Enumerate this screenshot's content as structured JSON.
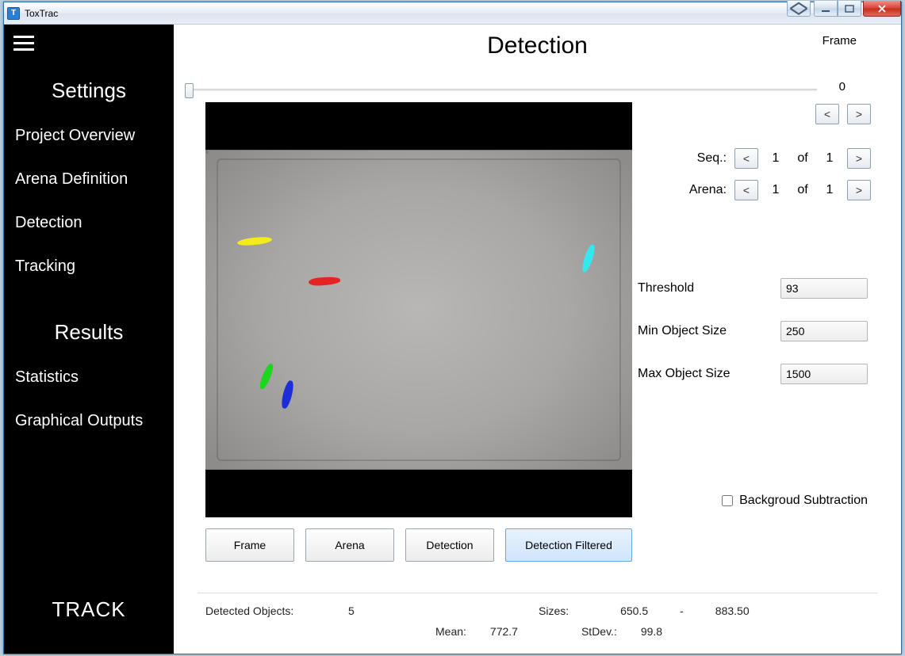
{
  "window": {
    "title": "ToxTrac",
    "icon_letter": "T"
  },
  "sidebar": {
    "sections": [
      {
        "title": "Settings",
        "items": [
          "Project Overview",
          "Arena Definition",
          "Detection",
          "Tracking"
        ]
      },
      {
        "title": "Results",
        "items": [
          "Statistics",
          "Graphical Outputs"
        ]
      }
    ],
    "track_button": "TRACK"
  },
  "page": {
    "title": "Detection",
    "frame_label": "Frame",
    "frame_value": "0"
  },
  "nav": {
    "seq": {
      "label": "Seq.:",
      "current": "1",
      "of": "of",
      "total": "1"
    },
    "arena": {
      "label": "Arena:",
      "current": "1",
      "of": "of",
      "total": "1"
    },
    "prev": "<",
    "next": ">"
  },
  "params": {
    "threshold": {
      "label": "Threshold",
      "value": "93"
    },
    "min_size": {
      "label": "Min Object Size",
      "value": "250"
    },
    "max_size": {
      "label": "Max Object Size",
      "value": "1500"
    },
    "bg_sub": {
      "label": "Backgroud Subtraction",
      "checked": false
    }
  },
  "tabs": {
    "frame": "Frame",
    "arena": "Arena",
    "detection": "Detection",
    "detection_filtered": "Detection Filtered"
  },
  "status": {
    "detected_label": "Detected Objects:",
    "detected_value": "5",
    "sizes_label": "Sizes:",
    "sizes_min": "650.5",
    "sizes_dash": "-",
    "sizes_max": "883.50",
    "mean_label": "Mean:",
    "mean_value": "772.7",
    "stdev_label": "StDev.:",
    "stdev_value": "99.8"
  },
  "blobs": [
    {
      "color": "#f5ea1a"
    },
    {
      "color": "#e52323"
    },
    {
      "color": "#33e8ee"
    },
    {
      "color": "#1fd61f"
    },
    {
      "color": "#1c2fd6"
    }
  ]
}
